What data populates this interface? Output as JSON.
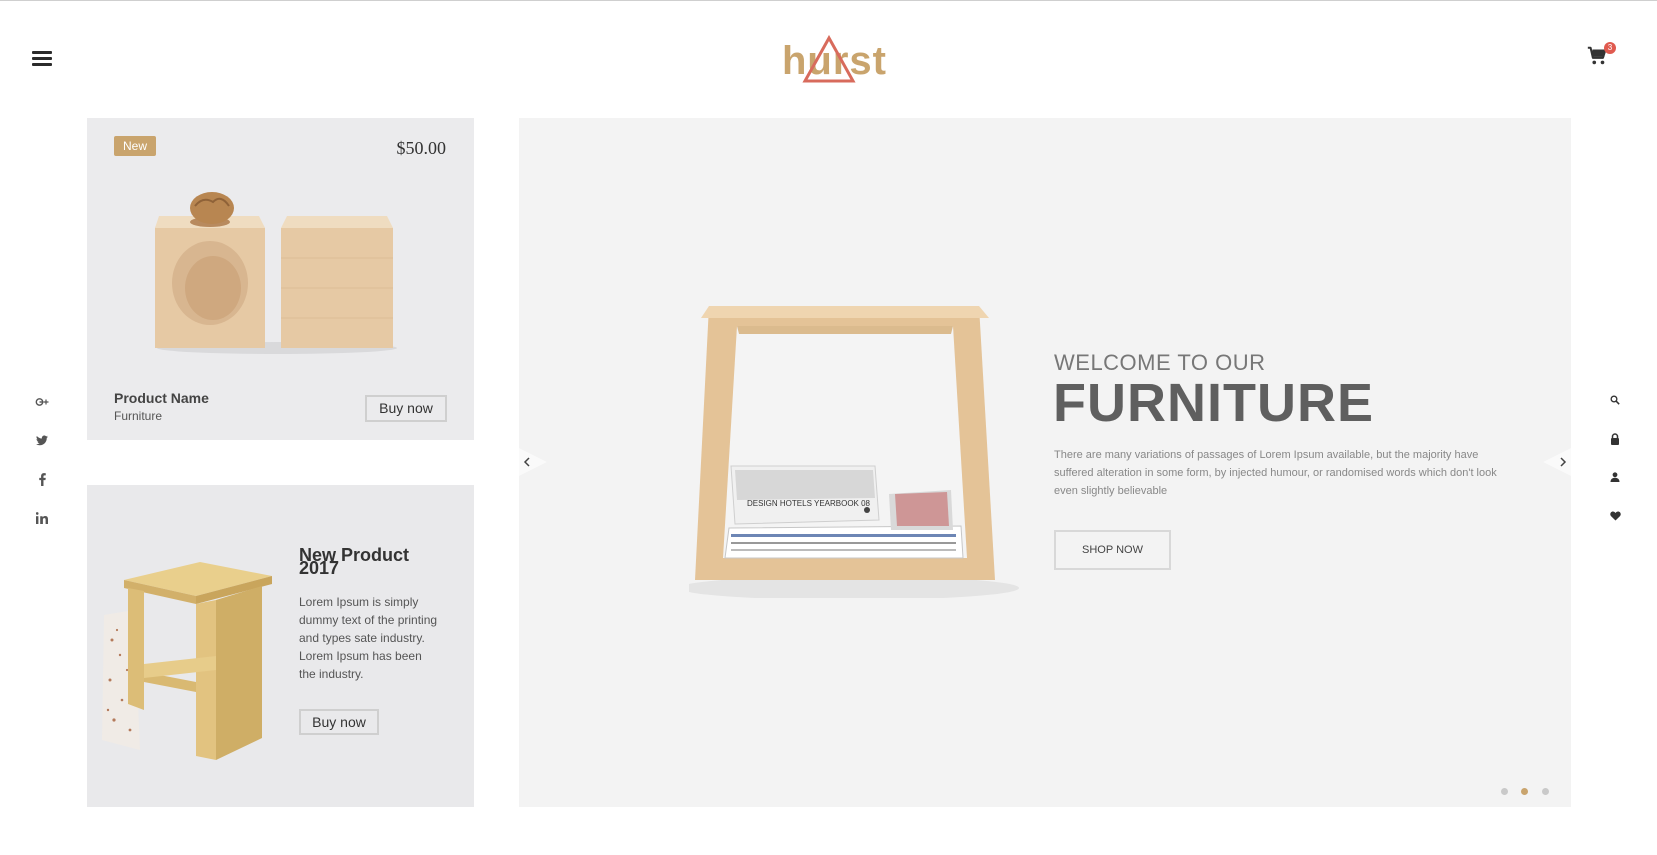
{
  "header": {
    "logo_text": "hurst",
    "cart_count": "3"
  },
  "social": [
    "google-plus",
    "twitter",
    "facebook",
    "linkedin"
  ],
  "right_icons": [
    "search",
    "lock",
    "user",
    "heart"
  ],
  "product_card": {
    "badge": "New",
    "price": "$50.00",
    "name": "Product Name",
    "category": "Furniture",
    "button": "Buy now"
  },
  "promo_card": {
    "title_line1": "New Product",
    "title_line2": "2017",
    "description": "Lorem Ipsum is simply dummy text of the printing and types sate industry. Lorem Ipsum has been the industry.",
    "button": "Buy now"
  },
  "hero": {
    "kicker": "WELCOME TO OUR",
    "headline": "FURNITURE",
    "description": "There are many variations of passages of Lorem Ipsum available, but the majority have suffered alteration in some form, by injected humour, or randomised words which don't look even slightly believable",
    "cta": "SHOP NOW",
    "book_label": "DESIGN HOTELS YEARBOOK 08",
    "slides_total": 3,
    "active_slide": 2
  },
  "colors": {
    "accent": "#c9a46d",
    "logo_triangle": "#d86b5c",
    "badge_red": "#e05a4f"
  }
}
